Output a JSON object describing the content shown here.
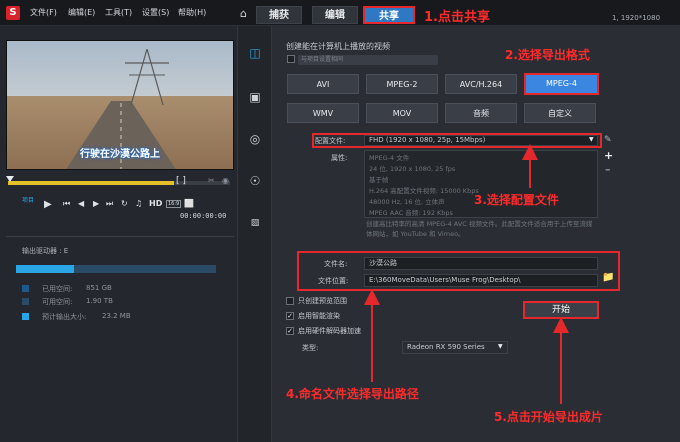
{
  "menu": [
    "文件(F)",
    "编辑(E)",
    "工具(T)",
    "设置(S)",
    "帮助(H)"
  ],
  "tabs": [
    {
      "label": "捕获",
      "active": false
    },
    {
      "label": "编辑",
      "active": false
    },
    {
      "label": "共享",
      "active": true
    }
  ],
  "resolution_readout": "1, 1920*1080",
  "annotations": {
    "step1": "1.点击共享",
    "step2": "2.选择导出格式",
    "step3": "3.选择配置文件",
    "step4": "4.命名文件选择导出路径",
    "step5": "5.点击开始导出成片"
  },
  "preview": {
    "subtitle": "行驶在沙漠公路上",
    "project_label": "项目",
    "hd_label": "HD",
    "ratio_label": "16:9",
    "timecode": "00:00:00:00"
  },
  "storage": {
    "drive_label": "输出驱动器 : E",
    "used_fraction": 0.29,
    "items": [
      {
        "label": "已用空间:",
        "value": "851 GB",
        "color": "#1b5a8a"
      },
      {
        "label": "可用空间:",
        "value": "1.90 TB",
        "color": "#2b4a66"
      },
      {
        "label": "预计输出大小:",
        "value": "23.2 MB",
        "color": "#2aa5e6"
      }
    ]
  },
  "share": {
    "heading": "创建能在计算机上播放的视频",
    "same_as_project": "与项目设置相同",
    "formats_row1": [
      "AVI",
      "MPEG-2",
      "AVC/H.264",
      "MPEG-4"
    ],
    "formats_row2": [
      "WMV",
      "MOV",
      "音频",
      "自定义"
    ],
    "selected_format": "MPEG-4",
    "profile_label": "配置文件:",
    "profile_value": "FHD (1920 x 1080, 25p, 15Mbps)",
    "props_label": "属性:",
    "props": [
      "MPEG-4 文件",
      "24 位, 1920 x 1080, 25 fps",
      "基于帧",
      "H.264 高配置文件视频: 15000 Kbps",
      "48000 Hz, 16 位, 立体声",
      "MPEG AAC 音频: 192 Kbps"
    ],
    "description": "创建高比特率的高清 MPEG-4 AVC 视频文件。此配置文件适合用于上传至流媒体网站，如 YouTube 和 Vimeo。",
    "filename_label": "文件名:",
    "filename_value": "沙漠公路",
    "location_label": "文件位置:",
    "location_value": "E:\\360MoveData\\Users\\Muse Frog\\Desktop\\",
    "options": [
      {
        "label": "只创建预览范围",
        "checked": false
      },
      {
        "label": "启用智能渲染",
        "checked": true
      },
      {
        "label": "启用硬件解码器加速",
        "checked": true
      }
    ],
    "type_label": "类型:",
    "type_value": "Radeon RX 590 Series",
    "start_button": "开始"
  }
}
